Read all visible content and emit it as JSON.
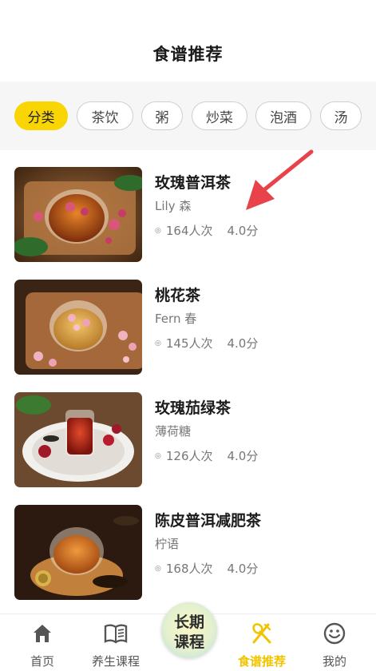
{
  "header": {
    "title": "食谱推荐"
  },
  "categories": [
    {
      "label": "分类",
      "active": true
    },
    {
      "label": "茶饮",
      "active": false
    },
    {
      "label": "粥",
      "active": false
    },
    {
      "label": "炒菜",
      "active": false
    },
    {
      "label": "泡酒",
      "active": false
    },
    {
      "label": "汤",
      "active": false
    }
  ],
  "recipes": [
    {
      "title": "玫瑰普洱茶",
      "author": "Lily 森",
      "views": "164人次",
      "score": "4.0分"
    },
    {
      "title": "桃花茶",
      "author": "Fern 春",
      "views": "145人次",
      "score": "4.0分"
    },
    {
      "title": "玫瑰茄绿茶",
      "author": "薄荷糖",
      "views": "126人次",
      "score": "4.0分"
    },
    {
      "title": "陈皮普洱减肥茶",
      "author": "柠语",
      "views": "168人次",
      "score": "4.0分"
    }
  ],
  "tabbar": {
    "items": [
      {
        "label": "首页",
        "icon": "home-icon",
        "active": false
      },
      {
        "label": "养生课程",
        "icon": "book-icon",
        "active": false
      },
      {
        "label": "食谱推荐",
        "icon": "fork-spoon-icon",
        "active": true
      },
      {
        "label": "我的",
        "icon": "smiley-icon",
        "active": false
      }
    ],
    "center": {
      "line1": "长期",
      "line2": "课程"
    }
  },
  "colors": {
    "accent": "#f9d503",
    "annotation_arrow": "#e8434a"
  }
}
